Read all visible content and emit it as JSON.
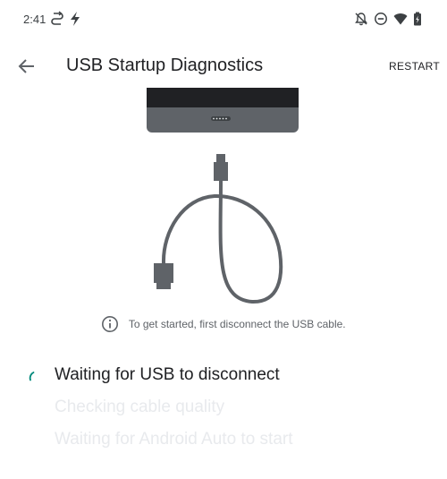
{
  "status_bar": {
    "time": "2:41",
    "left_icons": [
      "sync-icon",
      "flash-icon"
    ],
    "right_icons": [
      "notifications-off-icon",
      "do-not-disturb-icon",
      "wifi-icon",
      "battery-icon"
    ]
  },
  "app_bar": {
    "title": "USB Startup Diagnostics",
    "back_icon": "arrow-back-icon",
    "restart_label": "RESTART"
  },
  "info": {
    "icon": "info-icon",
    "text": "To get started, first disconnect the USB cable."
  },
  "steps": [
    {
      "label": "Waiting for USB to disconnect",
      "state": "active"
    },
    {
      "label": "Checking cable quality",
      "state": "pending"
    },
    {
      "label": "Waiting for Android Auto to start",
      "state": "pending"
    }
  ],
  "colors": {
    "accent": "#00897b",
    "text_primary": "#202124",
    "text_secondary": "#5f6368",
    "text_disabled": "#e8eaed",
    "device_dark": "#202124",
    "device_body": "#5f6368",
    "cable": "#5f6368"
  }
}
